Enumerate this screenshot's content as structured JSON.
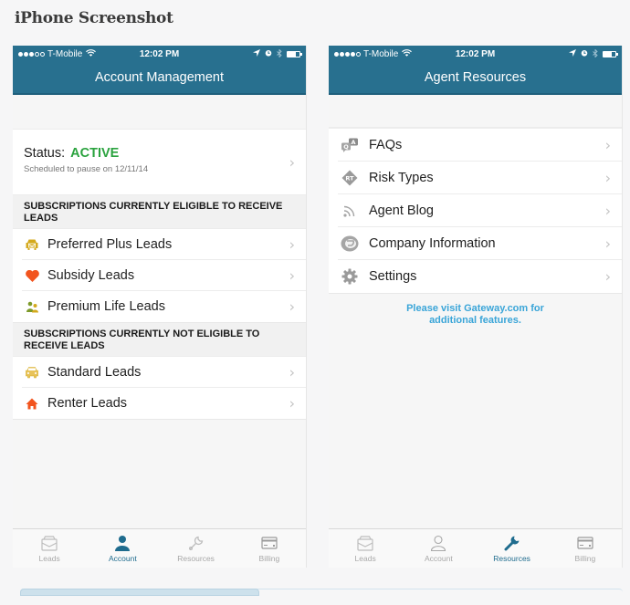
{
  "page_title": "iPhone Screenshot",
  "colors": {
    "brand": "#28708f",
    "active_status": "#2ba33f",
    "link": "#3aa5d8",
    "tab_active": "#1f6c8e",
    "tab_inactive": "#a8a8a8"
  },
  "left_phone": {
    "status_bar": {
      "signal_filled": 3,
      "signal_total": 5,
      "carrier": "T-Mobile",
      "time": "12:02 PM",
      "battery_level": 0.7
    },
    "nav_title": "Account Management",
    "status": {
      "label": "Status:",
      "value": "ACTIVE",
      "subtitle": "Scheduled to pause on 12/11/14"
    },
    "sections": [
      {
        "header": "SUBSCRIPTIONS CURRENTLY ELIGIBLE TO RECEIVE LEADS",
        "items": [
          {
            "label": "Preferred Plus Leads",
            "icon": "car-icon",
            "icon_color": "#d4a91c"
          },
          {
            "label": "Subsidy Leads",
            "icon": "heart-icon",
            "icon_color": "#f2541e"
          },
          {
            "label": "Premium Life Leads",
            "icon": "people-icon",
            "icon_color": "#7d9a2a"
          }
        ]
      },
      {
        "header": "SUBSCRIPTIONS CURRENTLY NOT ELIGIBLE TO RECEIVE LEADS",
        "items": [
          {
            "label": "Standard Leads",
            "icon": "car-outline-icon",
            "icon_color": "#e0b23a"
          },
          {
            "label": "Renter Leads",
            "icon": "house-icon",
            "icon_color": "#f2541e"
          }
        ]
      }
    ],
    "tabs": [
      {
        "label": "Leads",
        "icon": "inbox-icon",
        "active": false
      },
      {
        "label": "Account",
        "icon": "person-icon",
        "active": true
      },
      {
        "label": "Resources",
        "icon": "wrench-icon",
        "active": false
      },
      {
        "label": "Billing",
        "icon": "credit-card-icon",
        "active": false
      }
    ]
  },
  "right_phone": {
    "status_bar": {
      "signal_filled": 4,
      "signal_total": 5,
      "carrier": "T-Mobile",
      "time": "12:02 PM",
      "battery_level": 0.7
    },
    "nav_title": "Agent Resources",
    "items": [
      {
        "label": "FAQs",
        "icon": "qa-bubbles-icon"
      },
      {
        "label": "Risk Types",
        "icon": "rt-diamond-icon"
      },
      {
        "label": "Agent Blog",
        "icon": "rss-icon"
      },
      {
        "label": "Company Information",
        "icon": "company-logo-icon"
      },
      {
        "label": "Settings",
        "icon": "gear-icon"
      }
    ],
    "note": "Please visit Gateway.com for additional features.",
    "tabs": [
      {
        "label": "Leads",
        "icon": "inbox-icon",
        "active": false
      },
      {
        "label": "Account",
        "icon": "person-icon",
        "active": false
      },
      {
        "label": "Resources",
        "icon": "wrench-icon",
        "active": true
      },
      {
        "label": "Billing",
        "icon": "credit-card-icon",
        "active": false
      }
    ]
  }
}
